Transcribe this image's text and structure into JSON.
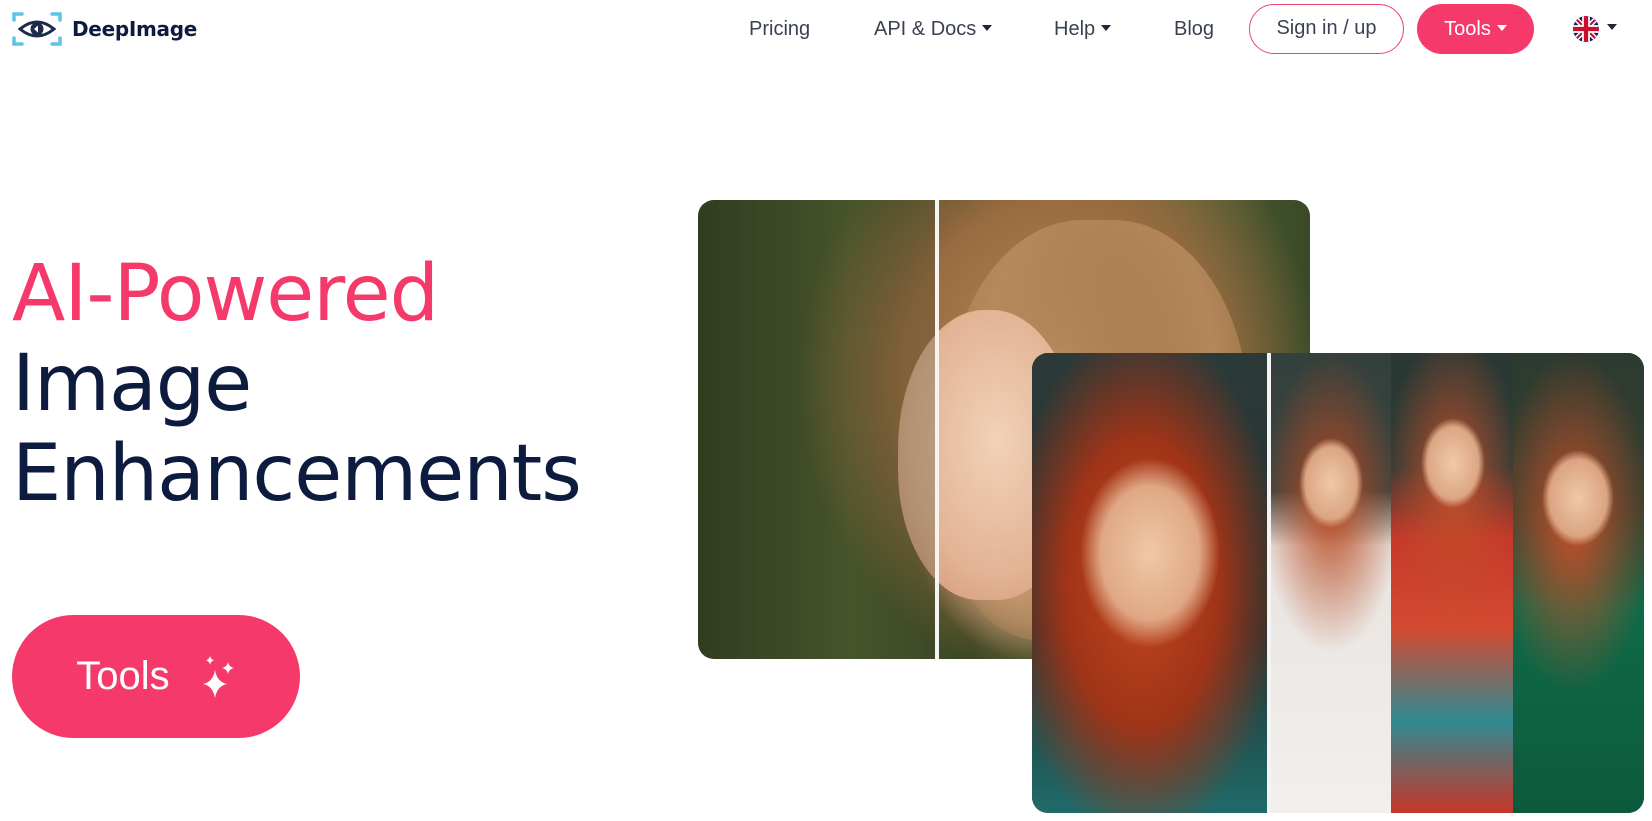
{
  "brand": {
    "name": "DeepImage",
    "logo_icon": "eye-icon"
  },
  "nav": {
    "pricing": "Pricing",
    "api_docs": "API & Docs",
    "help": "Help",
    "blog": "Blog",
    "signin": "Sign in / up",
    "tools": "Tools",
    "language_icon": "uk-flag-icon"
  },
  "hero": {
    "line1": "AI-Powered",
    "line2": "Image",
    "line3": "Enhancements",
    "cta_label": "Tools",
    "cta_icon": "sparkles-icon"
  },
  "colors": {
    "accent": "#f53a6b",
    "navy": "#0d1b3e",
    "nav_text": "#3a4252"
  }
}
